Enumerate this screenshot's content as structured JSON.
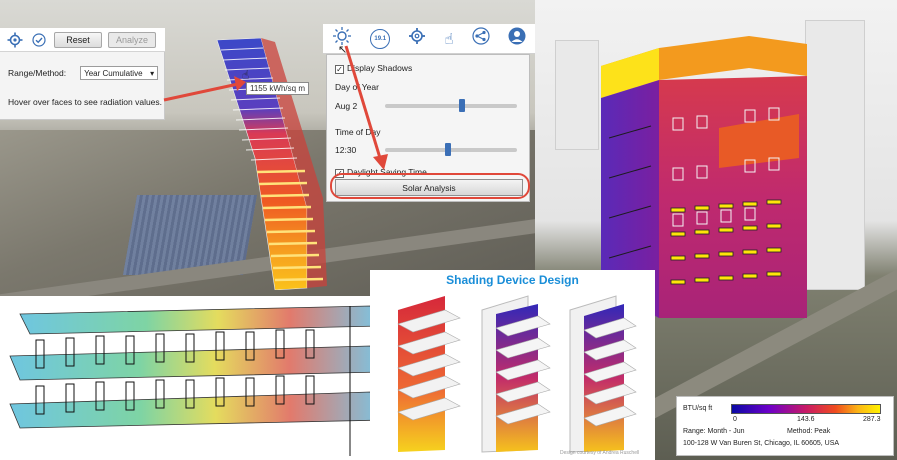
{
  "toolbar": {
    "reset_label": "Reset",
    "analyze_label": "Analyze"
  },
  "range": {
    "label": "Range/Method:",
    "selected": "Year Cumulative"
  },
  "hover_hint": "Hover over faces to see radiation values.",
  "tooltip_value": "1155 kWh/sq m",
  "shadow_panel": {
    "display_shadows": "Display Shadows",
    "day_of_year_label": "Day of Year",
    "date_value": "Aug 2",
    "time_of_day_label": "Time of Day",
    "time_value": "12:30",
    "daylight_saving": "Daylight Saving Time",
    "solar_button": "Solar Analysis"
  },
  "top_icons": [
    "sun-icon",
    "shading-icon",
    "gear-icon",
    "hand-icon",
    "share-icon",
    "user-icon"
  ],
  "top_icon_badge": "19.1",
  "shading_title": "Shading Device Design",
  "shading_credit": "Design courtesy of Andrea Ruschell",
  "legend": {
    "unit": "BTU/sq ft",
    "min": "0",
    "mid": "143.6",
    "max": "287.3",
    "range_text": "Range: Month - Jun",
    "method_text": "Method: Peak",
    "address": "100-128 W Van Buren St, Chicago, IL 60605, USA"
  },
  "colors": {
    "accent_red": "#e0483a",
    "heat_low": "#0a0aa5",
    "heat_mid": "#c81a66",
    "heat_high": "#fff200",
    "title_blue": "#1a8ed8"
  }
}
